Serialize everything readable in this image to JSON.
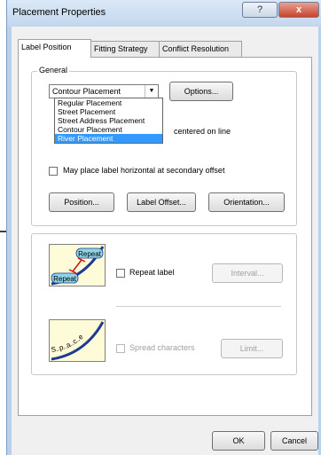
{
  "window": {
    "title": "Placement Properties",
    "help_glyph": "?",
    "close_glyph": "x"
  },
  "tabs": [
    {
      "label": "Label Position"
    },
    {
      "label": "Fitting Strategy"
    },
    {
      "label": "Conflict Resolution"
    }
  ],
  "general": {
    "group_label": "General",
    "combo_value": "Contour Placement",
    "options_button": "Options...",
    "dropdown_items": [
      "Regular Placement",
      "Street Placement",
      "Street Address Placement",
      "Contour Placement",
      "River Placement"
    ],
    "selected_index": 4,
    "partial_label": "centered on line",
    "secondary_offset_label": "May place label horizontal at secondary offset",
    "position_button": "Position...",
    "label_offset_button": "Label Offset...",
    "orientation_button": "Orientation..."
  },
  "repeat": {
    "illustration_text_top": "Repeat",
    "illustration_text_bottom": "Repeat",
    "checkbox_label": "Repeat label",
    "interval_button": "Interval..."
  },
  "spread": {
    "illustration_text": "S..p..a..c..e",
    "checkbox_label": "Spread characters",
    "limit_button": "Limit..."
  },
  "footer": {
    "ok_button": "OK",
    "cancel_button": "Cancel"
  },
  "colors": {
    "selection": "#3399ff",
    "close_button": "#c7442c",
    "illustration_bg": "#fdfbd8",
    "curve": "#1f3a93",
    "label_pill": "#8fd3e6"
  }
}
